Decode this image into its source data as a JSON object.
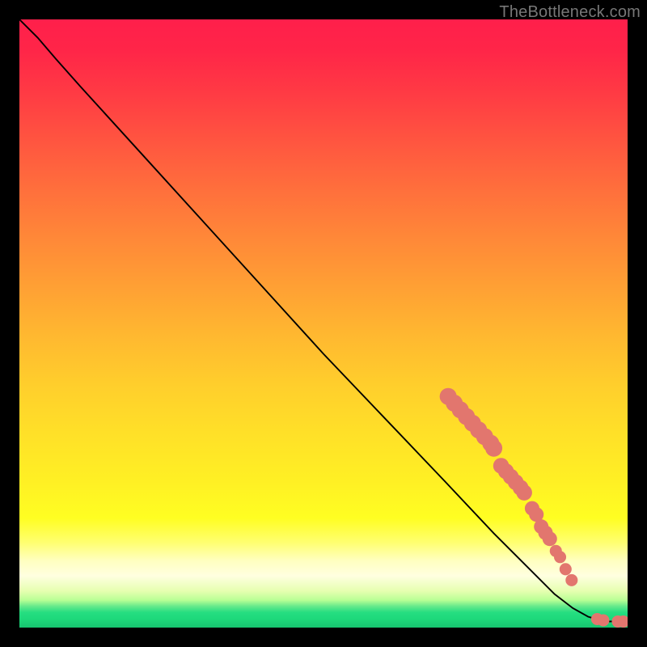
{
  "watermark": "TheBottleneck.com",
  "colors": {
    "marker": "#E2766E",
    "curve": "#000000",
    "bg_black": "#000000"
  },
  "chart_data": {
    "type": "line",
    "title": "",
    "xlabel": "",
    "ylabel": "",
    "xlim": [
      0,
      100
    ],
    "ylim": [
      0,
      100
    ],
    "gradient_stops": [
      {
        "offset": 0.0,
        "color": "#FF1F4B"
      },
      {
        "offset": 0.05,
        "color": "#FF2548"
      },
      {
        "offset": 0.12,
        "color": "#FF3A44"
      },
      {
        "offset": 0.2,
        "color": "#FF5540"
      },
      {
        "offset": 0.28,
        "color": "#FF6F3C"
      },
      {
        "offset": 0.36,
        "color": "#FF8838"
      },
      {
        "offset": 0.44,
        "color": "#FFA034"
      },
      {
        "offset": 0.52,
        "color": "#FFB830"
      },
      {
        "offset": 0.6,
        "color": "#FFCE2C"
      },
      {
        "offset": 0.68,
        "color": "#FFE028"
      },
      {
        "offset": 0.76,
        "color": "#FFF024"
      },
      {
        "offset": 0.82,
        "color": "#FFFE22"
      },
      {
        "offset": 0.86,
        "color": "#FFFF70"
      },
      {
        "offset": 0.89,
        "color": "#FFFFC0"
      },
      {
        "offset": 0.915,
        "color": "#FFFFE0"
      },
      {
        "offset": 0.94,
        "color": "#E6FFB0"
      },
      {
        "offset": 0.955,
        "color": "#B8FF95"
      },
      {
        "offset": 0.965,
        "color": "#65E98B"
      },
      {
        "offset": 0.975,
        "color": "#26DE81"
      },
      {
        "offset": 0.985,
        "color": "#1ED97B"
      },
      {
        "offset": 1.0,
        "color": "#17C46F"
      }
    ],
    "curve": [
      {
        "x": 0,
        "y": 100
      },
      {
        "x": 3,
        "y": 97
      },
      {
        "x": 6,
        "y": 93.5
      },
      {
        "x": 10,
        "y": 89
      },
      {
        "x": 20,
        "y": 78
      },
      {
        "x": 30,
        "y": 67
      },
      {
        "x": 40,
        "y": 56
      },
      {
        "x": 50,
        "y": 45
      },
      {
        "x": 60,
        "y": 34.5
      },
      {
        "x": 70,
        "y": 24
      },
      {
        "x": 78,
        "y": 15.5
      },
      {
        "x": 84,
        "y": 9.5
      },
      {
        "x": 88,
        "y": 5.5
      },
      {
        "x": 91,
        "y": 3.2
      },
      {
        "x": 93.5,
        "y": 1.8
      },
      {
        "x": 95.5,
        "y": 1.2
      },
      {
        "x": 97,
        "y": 1.0
      },
      {
        "x": 100,
        "y": 1.0
      }
    ],
    "markers_default_r": 1.2,
    "markers": [
      {
        "x": 70.5,
        "y": 38.0,
        "r": 1.4
      },
      {
        "x": 71.5,
        "y": 36.9,
        "r": 1.4
      },
      {
        "x": 72.5,
        "y": 35.8,
        "r": 1.4
      },
      {
        "x": 73.5,
        "y": 34.7,
        "r": 1.4
      },
      {
        "x": 74.5,
        "y": 33.6,
        "r": 1.4
      },
      {
        "x": 75.5,
        "y": 32.5,
        "r": 1.4
      },
      {
        "x": 76.5,
        "y": 31.4,
        "r": 1.4
      },
      {
        "x": 77.5,
        "y": 30.3,
        "r": 1.4
      },
      {
        "x": 78.0,
        "y": 29.5,
        "r": 1.4
      },
      {
        "x": 79.2,
        "y": 26.6,
        "r": 1.3
      },
      {
        "x": 80.0,
        "y": 25.7,
        "r": 1.3
      },
      {
        "x": 80.8,
        "y": 24.8,
        "r": 1.3
      },
      {
        "x": 81.6,
        "y": 23.9,
        "r": 1.3
      },
      {
        "x": 82.4,
        "y": 23.0,
        "r": 1.3
      },
      {
        "x": 83.0,
        "y": 22.2,
        "r": 1.3
      },
      {
        "x": 84.3,
        "y": 19.6,
        "r": 1.2
      },
      {
        "x": 85.0,
        "y": 18.6,
        "r": 1.2
      },
      {
        "x": 85.8,
        "y": 16.6,
        "r": 1.2
      },
      {
        "x": 86.5,
        "y": 15.6,
        "r": 1.2
      },
      {
        "x": 87.2,
        "y": 14.6,
        "r": 1.2
      },
      {
        "x": 88.2,
        "y": 12.6,
        "r": 1.0
      },
      {
        "x": 88.9,
        "y": 11.6,
        "r": 1.0
      },
      {
        "x": 89.8,
        "y": 9.6,
        "r": 1.0
      },
      {
        "x": 90.8,
        "y": 7.8,
        "r": 1.0
      },
      {
        "x": 95.0,
        "y": 1.4,
        "r": 1.0
      },
      {
        "x": 96.0,
        "y": 1.2,
        "r": 1.0
      },
      {
        "x": 98.4,
        "y": 1.0,
        "r": 1.0
      },
      {
        "x": 99.3,
        "y": 1.0,
        "r": 1.0
      }
    ]
  }
}
